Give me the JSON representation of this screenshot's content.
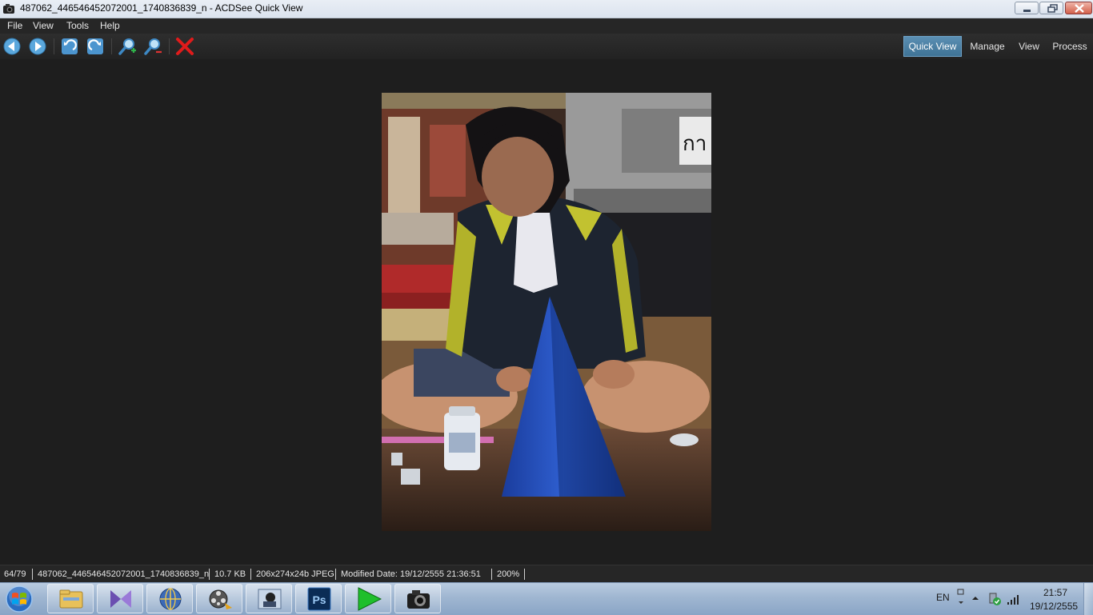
{
  "window": {
    "title": "487062_446546452072001_1740836839_n - ACDSee Quick View"
  },
  "menu": {
    "file": "File",
    "view": "View",
    "tools": "Tools",
    "help": "Help"
  },
  "toolbar": {
    "buttons": [
      "previous-icon",
      "next-icon",
      "rotate-left-icon",
      "rotate-right-icon",
      "zoom-in-icon",
      "zoom-out-icon",
      "delete-icon"
    ]
  },
  "modes": {
    "quick_view": "Quick View",
    "manage": "Manage",
    "view": "View",
    "process": "Process"
  },
  "status": {
    "position": "64/79",
    "filename": "487062_446546452072001_1740836839_n",
    "size": "10.7 KB",
    "dimensions": "206x274x24b JPEG",
    "modified": "Modified Date: 19/12/2555 21:36:51",
    "zoom": "200%"
  },
  "taskbar": {
    "apps": [
      "windows-explorer-icon",
      "visual-studio-icon",
      "network-globe-icon",
      "media-center-icon",
      "camera-app-icon",
      "photoshop-icon",
      "media-player-icon",
      "acdsee-camera-icon"
    ],
    "photoshop_label": "Ps",
    "language": "EN",
    "time": "21:57",
    "date": "19/12/2555"
  },
  "colors": {
    "accent": "#4b82a8",
    "background": "#1e1e1e",
    "delete": "#e01b1b"
  }
}
